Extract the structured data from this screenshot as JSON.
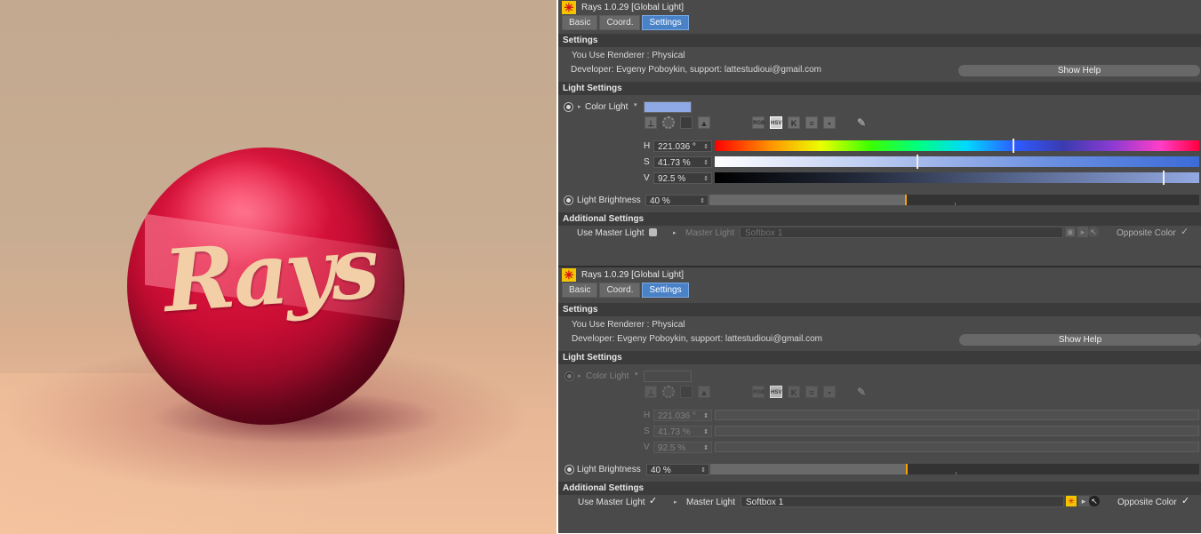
{
  "render": {
    "logo_text": "Rays"
  },
  "panel_top": {
    "title": "Rays 1.0.29 [Global Light]",
    "tabs": [
      "Basic",
      "Coord.",
      "Settings"
    ],
    "active_tab": "Settings",
    "settings_header": "Settings",
    "renderer_text": "You Use Renderer : Physical",
    "developer_text": "Developer: Evgeny Poboykin, support: lattestudioui@gmail.com",
    "show_help": "Show Help",
    "light_settings_header": "Light Settings",
    "color_light_label": "Color Light",
    "color_light_value": "#8fa8e6",
    "mode_icons": [
      "RGB",
      "HSV",
      "K"
    ],
    "active_mode": "HSV",
    "h_label": "H",
    "h_value": "221.036 °",
    "h_fraction": 0.614,
    "s_label": "S",
    "s_value": "41.73 %",
    "s_fraction": 0.4173,
    "v_label": "V",
    "v_value": "92.5 %",
    "v_fraction": 0.925,
    "brightness_label": "Light Brightness",
    "brightness_value": "40 %",
    "brightness_fraction": 0.4,
    "additional_header": "Additional Settings",
    "use_master_label": "Use Master Light",
    "use_master_checked": false,
    "master_light_label": "Master Light",
    "master_light_value": "Softbox 1",
    "opposite_color_label": "Opposite Color",
    "opposite_color_checked": true
  },
  "panel_bottom": {
    "title": "Rays 1.0.29 [Global Light]",
    "tabs": [
      "Basic",
      "Coord.",
      "Settings"
    ],
    "active_tab": "Settings",
    "settings_header": "Settings",
    "renderer_text": "You Use Renderer : Physical",
    "developer_text": "Developer: Evgeny Poboykin, support: lattestudioui@gmail.com",
    "show_help": "Show Help",
    "light_settings_header": "Light Settings",
    "color_light_label": "Color Light",
    "mode_icons": [
      "RGB",
      "HSV",
      "K"
    ],
    "active_mode": "HSV",
    "h_label": "H",
    "h_value": "221.036 °",
    "s_label": "S",
    "s_value": "41.73 %",
    "v_label": "V",
    "v_value": "92.5 %",
    "brightness_label": "Light Brightness",
    "brightness_value": "40 %",
    "brightness_fraction": 0.4,
    "additional_header": "Additional Settings",
    "use_master_label": "Use Master Light",
    "use_master_checked": true,
    "master_light_label": "Master Light",
    "master_light_value": "Softbox 1",
    "opposite_color_label": "Opposite Color",
    "opposite_color_checked": true
  }
}
